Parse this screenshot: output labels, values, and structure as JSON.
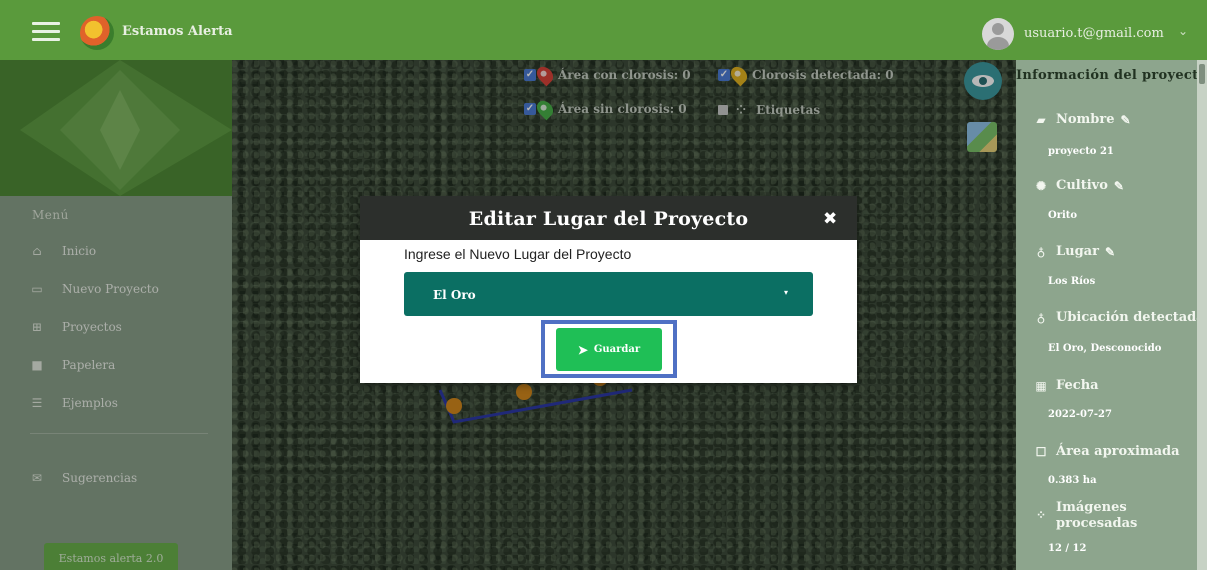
{
  "header": {
    "app_title": "Estamos Alerta",
    "user_email": "usuario.t@gmail.com",
    "user_caret": "⌄"
  },
  "sidebar": {
    "menu_heading": "Menú",
    "items": [
      {
        "label": "Inicio",
        "icon": "home-icon",
        "glyph": "⌂"
      },
      {
        "label": "Nuevo Proyecto",
        "icon": "new-project-icon",
        "glyph": "▭"
      },
      {
        "label": "Proyectos",
        "icon": "grid-icon",
        "glyph": "⊞"
      },
      {
        "label": "Papelera",
        "icon": "trash-grid-icon",
        "glyph": "■"
      },
      {
        "label": "Ejemplos",
        "icon": "list-icon",
        "glyph": "☰"
      },
      {
        "label": "Sugerencias",
        "icon": "envelope-icon",
        "glyph": "✉"
      }
    ],
    "bottom_button": "Estamos alerta 2.0"
  },
  "map": {
    "legend": {
      "area_clorosis": "Área con clorosis: 0",
      "clorosis_detectada": "Clorosis detectada: 0",
      "area_sin_clorosis": "Área sin clorosis: 0",
      "etiquetas": "Etiquetas"
    },
    "colors": {
      "pin_red": "#d9433a",
      "pin_yellow": "#e2b320",
      "pin_green": "#48b048",
      "pin_orange": "#d3881c",
      "polygon_blue": "#2d39a8"
    }
  },
  "right_panel": {
    "title": "Información del proyecto",
    "fields": [
      {
        "label": "Nombre",
        "value": "proyecto 21",
        "icon": "folder-icon",
        "glyph": "▰",
        "editable": true
      },
      {
        "label": "Cultivo",
        "value": "Orito",
        "icon": "gear-icon",
        "glyph": "✺",
        "editable": true
      },
      {
        "label": "Lugar",
        "value": "Los Ríos",
        "icon": "map-marker-icon",
        "glyph": "♁",
        "editable": true
      },
      {
        "label": "Ubicación detectada",
        "value": "El Oro, Desconocido",
        "icon": "map-marker-icon",
        "glyph": "♁",
        "editable": false
      },
      {
        "label": "Fecha",
        "value": "2022-07-27",
        "icon": "calendar-icon",
        "glyph": "▦",
        "editable": false
      },
      {
        "label": "Área aproximada",
        "value": "0.383 ha",
        "icon": "square-icon",
        "glyph": "☐",
        "editable": false
      },
      {
        "label": "Imágenes procesadas",
        "value": "12 / 12",
        "icon": "spinner-icon",
        "glyph": "⁘",
        "editable": false
      }
    ],
    "pencil_glyph": "✎"
  },
  "modal": {
    "title": "Editar Lugar del Proyecto",
    "close_glyph": "✖",
    "prompt": "Ingrese el Nuevo Lugar del Proyecto",
    "selected_option": "El Oro",
    "caret_glyph": "▾",
    "save_label": "Guardar",
    "save_glyph": "➤"
  }
}
